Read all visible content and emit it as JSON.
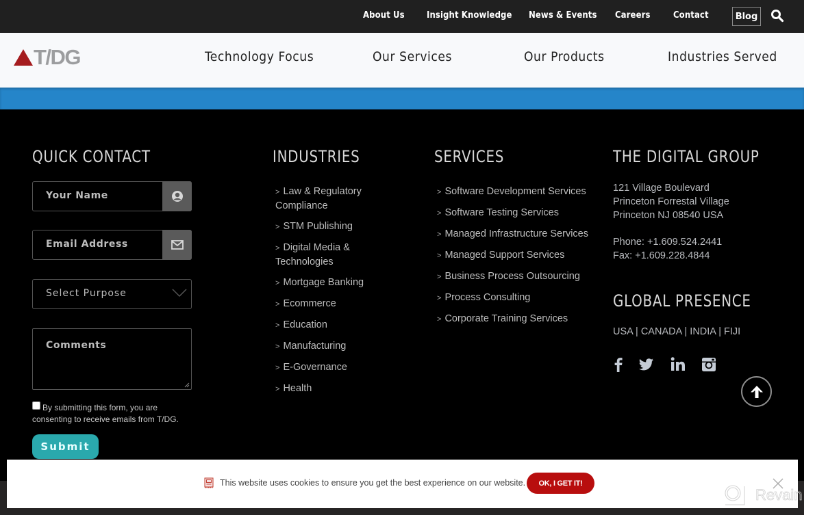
{
  "topbar": {
    "links": [
      "About Us",
      "Insight Knowledge",
      "News & Events",
      "Careers",
      "Contact"
    ],
    "blog_label": "Blog",
    "search_icon": "search-icon"
  },
  "header": {
    "logo_text": "T/DG",
    "nav": [
      "Technology Focus",
      "Our Services",
      "Our Products",
      "Industries Served"
    ]
  },
  "colors": {
    "topbar_bg": "#202020",
    "accent_blue": "#2585c9",
    "logo_red": "#a51c1f",
    "submit_teal": "#2aa9ad",
    "cookie_button_red": "#b80e0e"
  },
  "quick_contact": {
    "title": "QUICK CONTACT",
    "name_placeholder": "Your Name",
    "email_placeholder": "Email Address",
    "purpose_placeholder": "Select Purpose",
    "comments_placeholder": "Comments",
    "consent_text": "By submitting this form, you are consenting to receive emails from T/DG.",
    "consent_checked": false,
    "submit_label": "Submit"
  },
  "industries": {
    "title": "INDUSTRIES",
    "items": [
      "Law & Regulatory Compliance",
      "STM Publishing",
      "Digital Media & Technologies",
      "Mortgage Banking",
      "Ecommerce",
      "Education",
      "Manufacturing",
      "E-Governance",
      "Health"
    ]
  },
  "services": {
    "title": "SERVICES",
    "items": [
      "Software Development Services",
      "Software Testing Services",
      "Managed Infrastructure Services",
      "Managed Support Services",
      "Business Process Outsourcing",
      "Process Consulting",
      "Corporate Training Services"
    ]
  },
  "company": {
    "title": "THE DIGITAL GROUP",
    "address": [
      "121 Village Boulevard",
      "Princeton Forrestal Village",
      "Princeton NJ 08540 USA"
    ],
    "phone": "Phone: +1.609.524.2441",
    "fax": "Fax: +1.609.228.4844",
    "presence_title": "GLOBAL PRESENCE",
    "presence_text": "USA | CANADA | INDIA | FIJI",
    "social": [
      "facebook-icon",
      "twitter-icon",
      "linkedin-icon",
      "instagram-icon"
    ]
  },
  "cookie": {
    "text": "This website uses cookies to ensure you get the best experience on our website.",
    "button_label": "OK, I GET IT!"
  },
  "watermark": {
    "text": "Revain"
  }
}
